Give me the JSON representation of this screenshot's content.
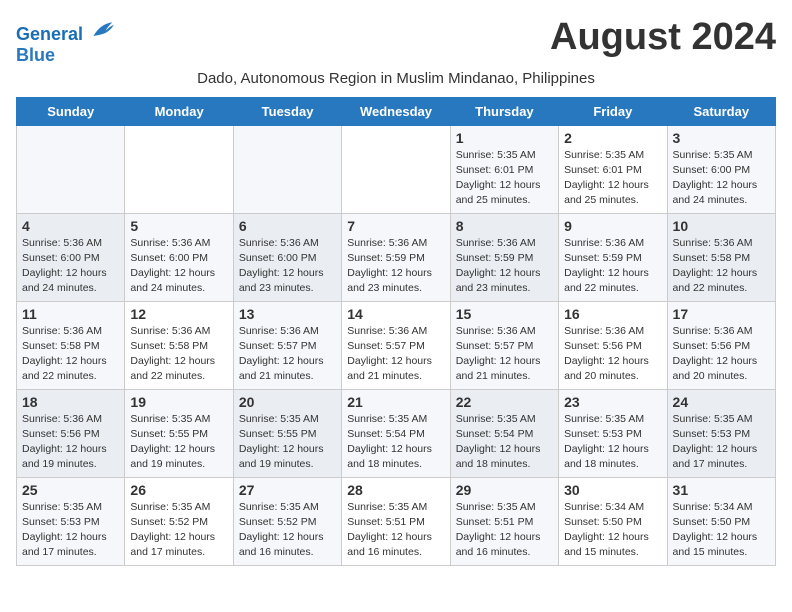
{
  "header": {
    "logo_line1": "General",
    "logo_line2": "Blue",
    "month_year": "August 2024",
    "subtitle": "Dado, Autonomous Region in Muslim Mindanao, Philippines"
  },
  "weekdays": [
    "Sunday",
    "Monday",
    "Tuesday",
    "Wednesday",
    "Thursday",
    "Friday",
    "Saturday"
  ],
  "weeks": [
    [
      {
        "day": "",
        "info": ""
      },
      {
        "day": "",
        "info": ""
      },
      {
        "day": "",
        "info": ""
      },
      {
        "day": "",
        "info": ""
      },
      {
        "day": "1",
        "info": "Sunrise: 5:35 AM\nSunset: 6:01 PM\nDaylight: 12 hours\nand 25 minutes."
      },
      {
        "day": "2",
        "info": "Sunrise: 5:35 AM\nSunset: 6:01 PM\nDaylight: 12 hours\nand 25 minutes."
      },
      {
        "day": "3",
        "info": "Sunrise: 5:35 AM\nSunset: 6:00 PM\nDaylight: 12 hours\nand 24 minutes."
      }
    ],
    [
      {
        "day": "4",
        "info": "Sunrise: 5:36 AM\nSunset: 6:00 PM\nDaylight: 12 hours\nand 24 minutes."
      },
      {
        "day": "5",
        "info": "Sunrise: 5:36 AM\nSunset: 6:00 PM\nDaylight: 12 hours\nand 24 minutes."
      },
      {
        "day": "6",
        "info": "Sunrise: 5:36 AM\nSunset: 6:00 PM\nDaylight: 12 hours\nand 23 minutes."
      },
      {
        "day": "7",
        "info": "Sunrise: 5:36 AM\nSunset: 5:59 PM\nDaylight: 12 hours\nand 23 minutes."
      },
      {
        "day": "8",
        "info": "Sunrise: 5:36 AM\nSunset: 5:59 PM\nDaylight: 12 hours\nand 23 minutes."
      },
      {
        "day": "9",
        "info": "Sunrise: 5:36 AM\nSunset: 5:59 PM\nDaylight: 12 hours\nand 22 minutes."
      },
      {
        "day": "10",
        "info": "Sunrise: 5:36 AM\nSunset: 5:58 PM\nDaylight: 12 hours\nand 22 minutes."
      }
    ],
    [
      {
        "day": "11",
        "info": "Sunrise: 5:36 AM\nSunset: 5:58 PM\nDaylight: 12 hours\nand 22 minutes."
      },
      {
        "day": "12",
        "info": "Sunrise: 5:36 AM\nSunset: 5:58 PM\nDaylight: 12 hours\nand 22 minutes."
      },
      {
        "day": "13",
        "info": "Sunrise: 5:36 AM\nSunset: 5:57 PM\nDaylight: 12 hours\nand 21 minutes."
      },
      {
        "day": "14",
        "info": "Sunrise: 5:36 AM\nSunset: 5:57 PM\nDaylight: 12 hours\nand 21 minutes."
      },
      {
        "day": "15",
        "info": "Sunrise: 5:36 AM\nSunset: 5:57 PM\nDaylight: 12 hours\nand 21 minutes."
      },
      {
        "day": "16",
        "info": "Sunrise: 5:36 AM\nSunset: 5:56 PM\nDaylight: 12 hours\nand 20 minutes."
      },
      {
        "day": "17",
        "info": "Sunrise: 5:36 AM\nSunset: 5:56 PM\nDaylight: 12 hours\nand 20 minutes."
      }
    ],
    [
      {
        "day": "18",
        "info": "Sunrise: 5:36 AM\nSunset: 5:56 PM\nDaylight: 12 hours\nand 19 minutes."
      },
      {
        "day": "19",
        "info": "Sunrise: 5:35 AM\nSunset: 5:55 PM\nDaylight: 12 hours\nand 19 minutes."
      },
      {
        "day": "20",
        "info": "Sunrise: 5:35 AM\nSunset: 5:55 PM\nDaylight: 12 hours\nand 19 minutes."
      },
      {
        "day": "21",
        "info": "Sunrise: 5:35 AM\nSunset: 5:54 PM\nDaylight: 12 hours\nand 18 minutes."
      },
      {
        "day": "22",
        "info": "Sunrise: 5:35 AM\nSunset: 5:54 PM\nDaylight: 12 hours\nand 18 minutes."
      },
      {
        "day": "23",
        "info": "Sunrise: 5:35 AM\nSunset: 5:53 PM\nDaylight: 12 hours\nand 18 minutes."
      },
      {
        "day": "24",
        "info": "Sunrise: 5:35 AM\nSunset: 5:53 PM\nDaylight: 12 hours\nand 17 minutes."
      }
    ],
    [
      {
        "day": "25",
        "info": "Sunrise: 5:35 AM\nSunset: 5:53 PM\nDaylight: 12 hours\nand 17 minutes."
      },
      {
        "day": "26",
        "info": "Sunrise: 5:35 AM\nSunset: 5:52 PM\nDaylight: 12 hours\nand 17 minutes."
      },
      {
        "day": "27",
        "info": "Sunrise: 5:35 AM\nSunset: 5:52 PM\nDaylight: 12 hours\nand 16 minutes."
      },
      {
        "day": "28",
        "info": "Sunrise: 5:35 AM\nSunset: 5:51 PM\nDaylight: 12 hours\nand 16 minutes."
      },
      {
        "day": "29",
        "info": "Sunrise: 5:35 AM\nSunset: 5:51 PM\nDaylight: 12 hours\nand 16 minutes."
      },
      {
        "day": "30",
        "info": "Sunrise: 5:34 AM\nSunset: 5:50 PM\nDaylight: 12 hours\nand 15 minutes."
      },
      {
        "day": "31",
        "info": "Sunrise: 5:34 AM\nSunset: 5:50 PM\nDaylight: 12 hours\nand 15 minutes."
      }
    ]
  ]
}
